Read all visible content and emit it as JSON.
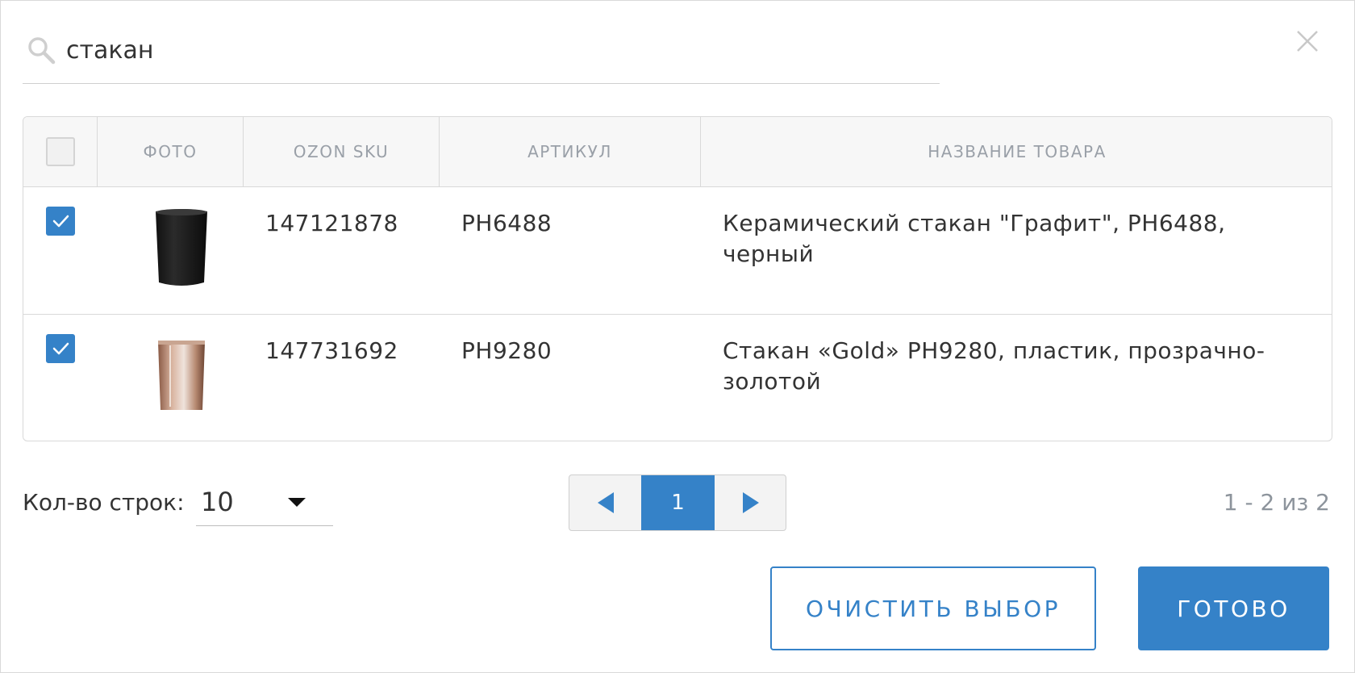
{
  "search": {
    "value": "стакан",
    "icon": "search-icon"
  },
  "close_icon": "close-icon",
  "table": {
    "headers": {
      "photo": "ФОТО",
      "sku": "OZON SKU",
      "article": "АРТИКУЛ",
      "name": "НАЗВАНИЕ ТОВАРА"
    },
    "select_all_checked": false,
    "rows": [
      {
        "checked": true,
        "photo": "black-ceramic-cup-image",
        "sku": "147121878",
        "article": "PH6488",
        "name": "Керамический стакан \"Графит\", PH6488, черный"
      },
      {
        "checked": true,
        "photo": "gold-plastic-cup-image",
        "sku": "147731692",
        "article": "PH9280",
        "name": "Стакан «Gold» PH9280, пластик, прозрачно-золотой"
      }
    ]
  },
  "footer": {
    "rows_label": "Кол-во строк:",
    "rows_value": "10",
    "current_page": "1",
    "range_text": "1 - 2 из 2"
  },
  "buttons": {
    "clear": "ОЧИСТИТЬ ВЫБОР",
    "done": "ГОТОВО"
  },
  "colors": {
    "accent": "#3582c8",
    "header_text": "#9aa0a8",
    "border": "#d9d9d9"
  }
}
